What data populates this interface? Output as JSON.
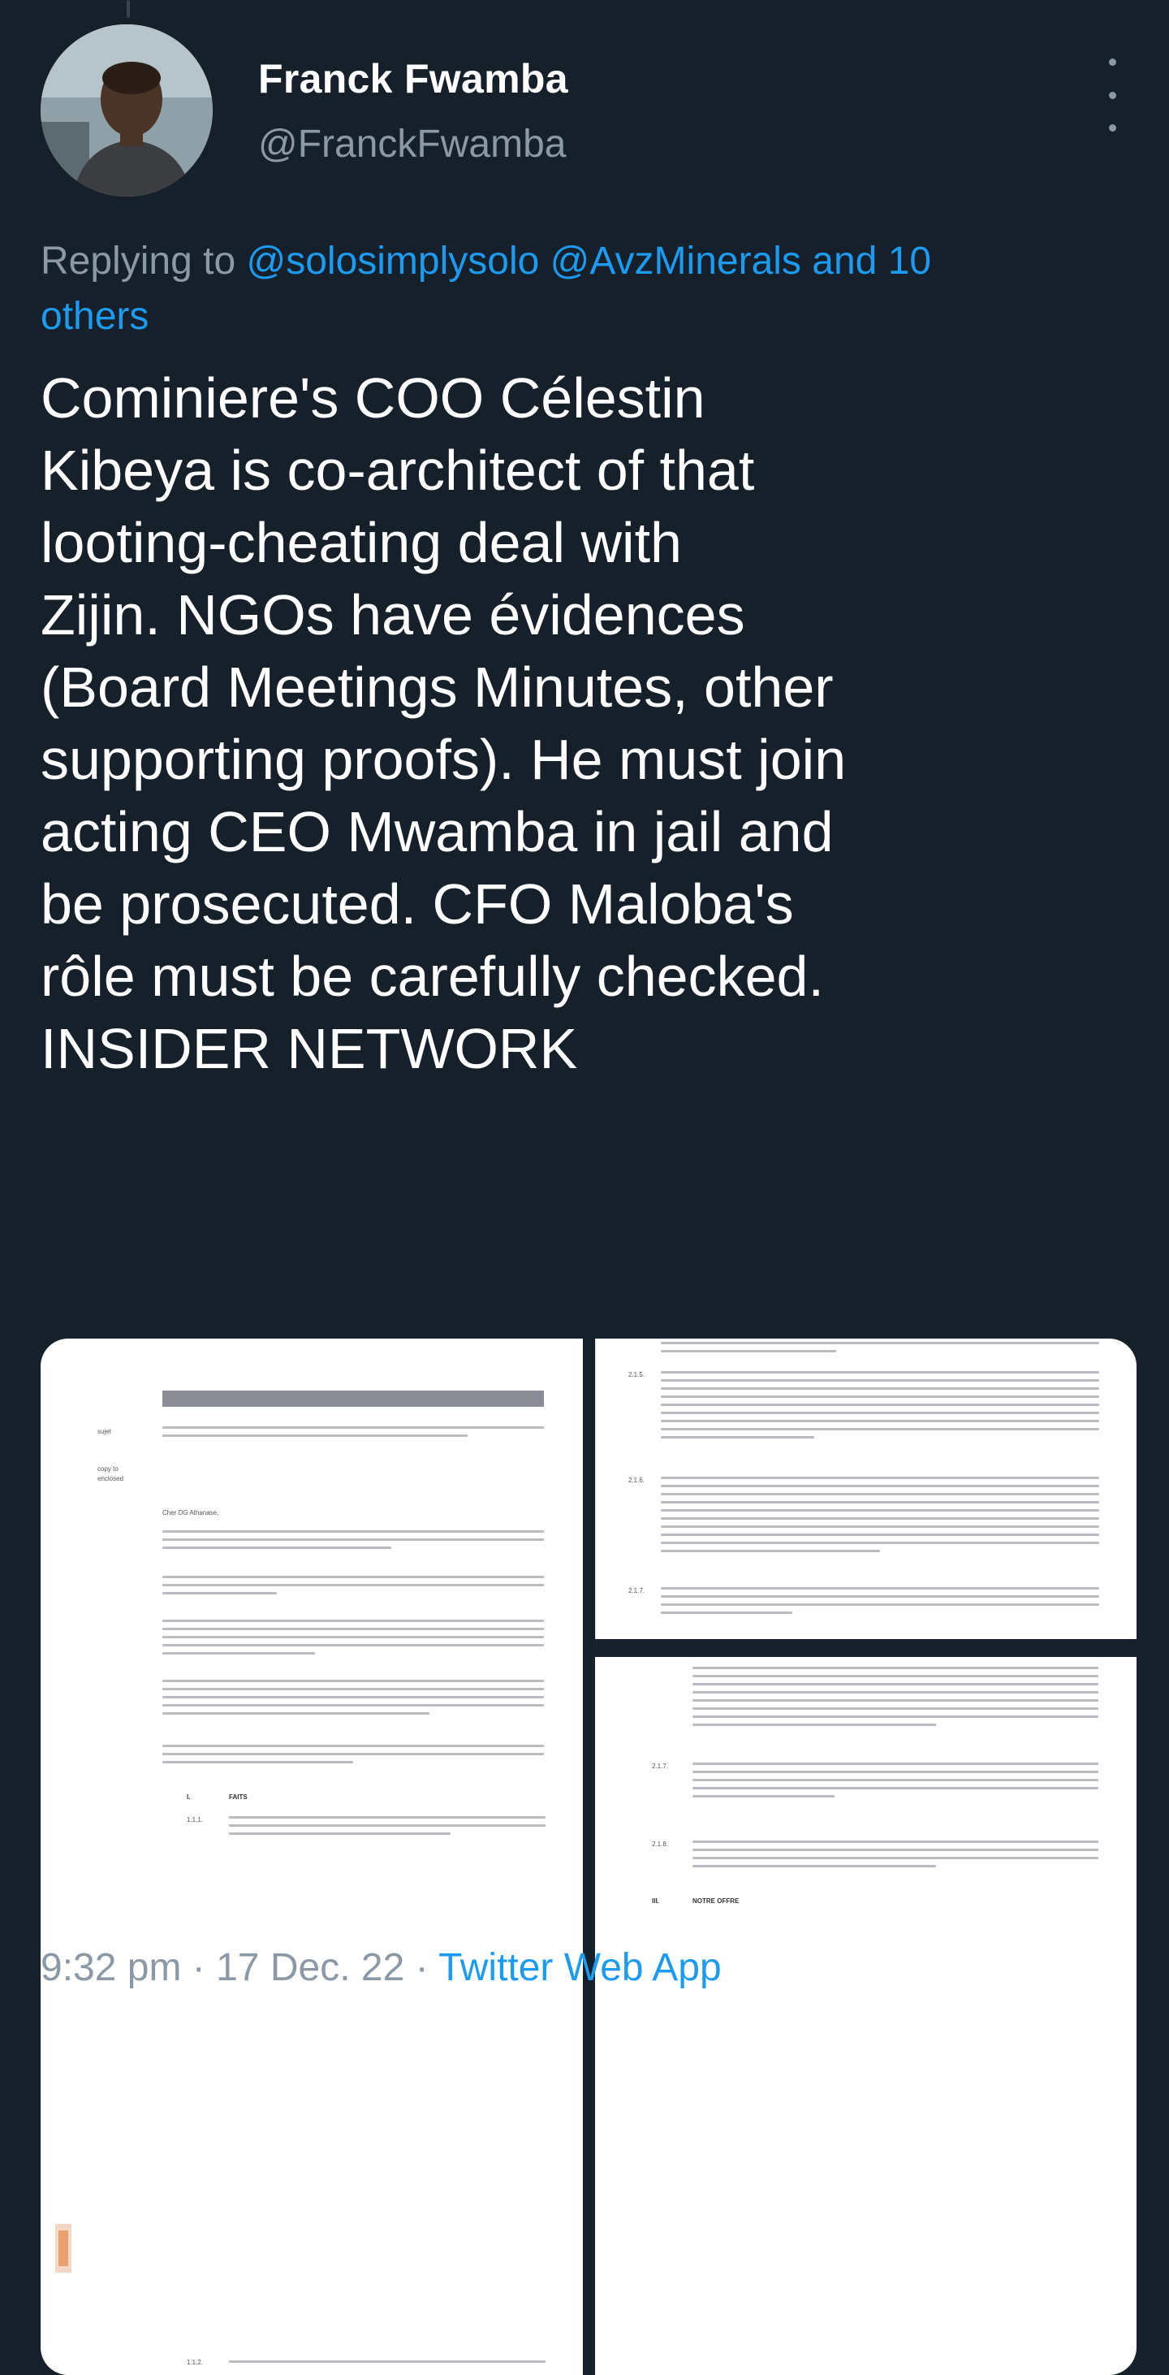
{
  "author": {
    "name": "Franck Fwamba",
    "handle": "@FranckFwamba"
  },
  "reply": {
    "prefix": "Replying to",
    "mention_1": "@solosimplysolo",
    "mention_2": "@AvzMinerals",
    "suffix_1": "and 10",
    "suffix_2": "others"
  },
  "tweet": {
    "lines": [
      "Cominiere's COO Célestin",
      "Kibeya is co-architect of that",
      "looting-cheating deal with",
      "Zijin. NGOs have évidences",
      "(Board Meetings Minutes, other",
      "supporting proofs). He must join",
      "acting CEO Mwamba in jail and",
      "be prosecuted. CFO Maloba's",
      "rôle must be carefully checked.",
      "INSIDER NETWORK"
    ]
  },
  "media": {
    "left_doc": {
      "labels": [
        "sujet",
        "copy to",
        "enclosed"
      ],
      "greeting": "Cher DG Athanase,",
      "section_1": "I.",
      "section_1_title": "FAITS",
      "clause_1": "1.1.1.",
      "clause_2": "1.1.2."
    },
    "right_top_doc": {
      "clauses": [
        "2.1.5.",
        "2.1.6.",
        "2.1.7."
      ]
    },
    "right_bottom_doc": {
      "clauses": [
        "2.1.7.",
        "2.1.8.",
        "III."
      ],
      "section_title": "NOTRE OFFRE"
    }
  },
  "footer": {
    "time": "9:32 pm",
    "sep_1": "·",
    "date": "17 Dec. 22",
    "sep_2": "·",
    "source": "Twitter Web App"
  },
  "colors": {
    "background": "#15202b",
    "accent": "#1d9bf0",
    "secondary_text": "#8b98a5"
  }
}
